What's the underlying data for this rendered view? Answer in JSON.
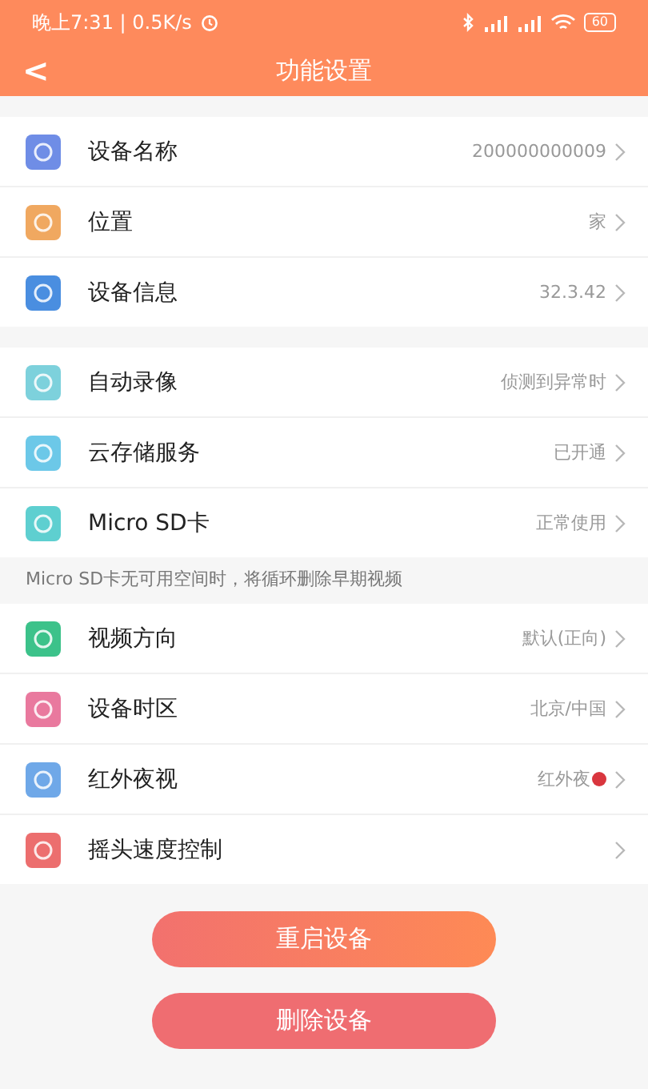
{
  "status_bar": {
    "time": "晚上7:31 | 0.5K/s",
    "battery": "60"
  },
  "header": {
    "back": "<",
    "title": "功能设置"
  },
  "sections": [
    {
      "rows": [
        {
          "label": "设备名称",
          "value": "200000000009",
          "color": "#6f8de6",
          "badge": false
        },
        {
          "label": "位置",
          "value": "家",
          "color": "#f0a860",
          "badge": false
        },
        {
          "label": "设备信息",
          "value": "32.3.42",
          "color": "#4a8ee0",
          "badge": false
        }
      ]
    },
    {
      "rows": [
        {
          "label": "自动录像",
          "value": "侦测到异常时",
          "color": "#7dd1dc",
          "badge": false
        },
        {
          "label": "云存储服务",
          "value": "已开通",
          "color": "#6cc8e8",
          "badge": false
        },
        {
          "label": "Micro SD卡",
          "value": "正常使用",
          "color": "#5ecfd0",
          "badge": false
        }
      ],
      "footer": "Micro SD卡无可用空间时，将循环删除早期视频"
    },
    {
      "rows": [
        {
          "label": "视频方向",
          "value": "默认(正向)",
          "color": "#3cc28a",
          "badge": false
        },
        {
          "label": "设备时区",
          "value": "北京/中国",
          "color": "#e9799e",
          "badge": false
        },
        {
          "label": "红外夜视",
          "value": "红外夜",
          "color": "#6fa8e8",
          "badge": true
        },
        {
          "label": "摇头速度控制",
          "color": "#ec6e6e",
          "badge": false
        }
      ]
    }
  ],
  "buttons": [
    {
      "label": "重启设备",
      "kind": "gradient"
    },
    {
      "label": "删除设备",
      "kind": "solid"
    }
  ]
}
